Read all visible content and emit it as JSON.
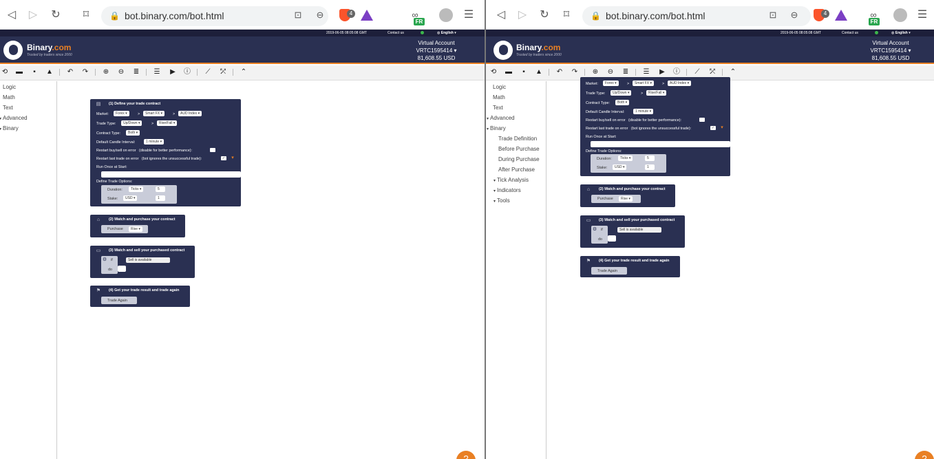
{
  "browser": {
    "url": "bot.binary.com/bot.html",
    "shield_count": "4",
    "lang_badge": "FR"
  },
  "site": {
    "datetime": "2019-06-05 08:05:08 GMT",
    "contact": "Contact us",
    "language": "English",
    "brand_name": "Binary",
    "brand_suffix": ".com",
    "tagline": "Trusted by traders since 2000",
    "account_type": "Virtual Account",
    "account_id": "VRTC1595414",
    "balance": "81,608.55 USD",
    "accent_color": "#e98024",
    "header_color": "#2a3052"
  },
  "toolbar_icons": [
    "reset-icon",
    "open-icon",
    "save-icon",
    "drive-icon",
    "undo-icon",
    "redo-icon",
    "zoom-in-icon",
    "zoom-out-icon",
    "rearrange-icon",
    "summary-icon",
    "run-icon",
    "info-icon",
    "chart-icon",
    "trading-view-icon",
    "collapse-icon"
  ],
  "toolbox": {
    "logic": "Logic",
    "math": "Math",
    "text": "Text",
    "advanced": "Advanced",
    "binary": "Binary",
    "trade_definition": "Trade Definition",
    "before_purchase": "Before Purchase",
    "during_purchase": "During Purchase",
    "after_purchase": "After Purchase",
    "tick_analysis": "Tick Analysis",
    "indicators": "Indicators",
    "tools": "Tools"
  },
  "blocks": {
    "define_title": "(1) Define your trade contract",
    "market_label": "Market:",
    "market": "Forex",
    "submarket": "Smart FX",
    "symbol": "AUD Index",
    "trade_type_label": "Trade Type:",
    "trade_category": "Up/Down",
    "trade_type": "Rise/Fall",
    "contract_type_label": "Contract Type:",
    "contract_type": "Both",
    "candle_label": "Default Candle Interval:",
    "candle": "1 minute",
    "restart_buysell": "Restart buy/sell on error",
    "restart_buysell_note": "(disable for better performance):",
    "restart_last": "Restart last trade on error",
    "restart_last_note": "(bot ignores the unsuccessful trade):",
    "run_once": "Run Once at Start:",
    "trade_options": "Define Trade Options:",
    "duration_label": "Duration:",
    "duration_unit": "Ticks",
    "duration_value": "5",
    "stake_label": "Stake:",
    "currency": "USD",
    "stake_value": "1",
    "purchase_title": "(2) Watch and purchase your contract",
    "purchase_label": "Purchase",
    "purchase_value": "Rise",
    "sell_title": "(3) Watch and sell your purchased contract",
    "if_label": "if",
    "sell_available": "Sell is available",
    "do_label": "do",
    "result_title": "(4) Get your trade result and trade again",
    "trade_again": "Trade Again"
  },
  "help_glyph": "?"
}
